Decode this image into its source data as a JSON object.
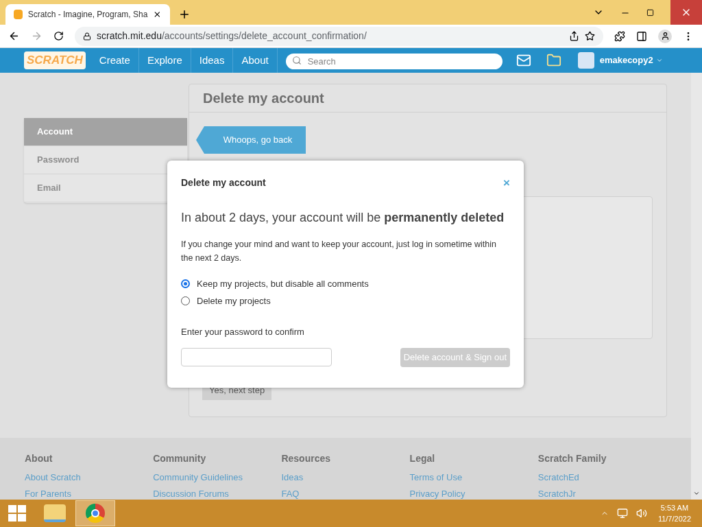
{
  "browser": {
    "tab_title": "Scratch - Imagine, Program, Sha",
    "url_host": "scratch.mit.edu",
    "url_path": "/accounts/settings/delete_account_confirmation/"
  },
  "nav": {
    "logo": "SCRATCH",
    "items": [
      "Create",
      "Explore",
      "Ideas",
      "About"
    ],
    "search_placeholder": "Search",
    "username": "emakecopy2"
  },
  "sidebar": [
    {
      "label": "Account",
      "selected": true
    },
    {
      "label": "Password",
      "selected": false
    },
    {
      "label": "Email",
      "selected": false
    }
  ],
  "main": {
    "title": "Delete my account",
    "back_button": "Whoops, go back",
    "next_button": "Yes, next step"
  },
  "modal": {
    "title": "Delete my account",
    "close": "×",
    "heading": "In about 2 days, your account will be **permanently deleted**",
    "body": "If you change your mind and want to keep your account, just log in sometime within the next 2 days.",
    "options": [
      {
        "label": "Keep my projects, but disable all comments",
        "selected": true
      },
      {
        "label": "Delete my projects",
        "selected": false
      }
    ],
    "password_label": "Enter your password to confirm",
    "submit": {
      "label": "Delete account & Sign out",
      "disabled": true
    }
  },
  "footer": [
    {
      "heading": "About",
      "links": [
        "About Scratch",
        "For Parents"
      ]
    },
    {
      "heading": "Community",
      "links": [
        "Community Guidelines",
        "Discussion Forums"
      ]
    },
    {
      "heading": "Resources",
      "links": [
        "Ideas",
        "FAQ"
      ]
    },
    {
      "heading": "Legal",
      "links": [
        "Terms of Use",
        "Privacy Policy"
      ]
    },
    {
      "heading": "Scratch Family",
      "links": [
        "ScratchEd",
        "ScratchJr"
      ]
    }
  ],
  "taskbar": {
    "time": "5:53 AM",
    "date": "11/7/2022"
  }
}
